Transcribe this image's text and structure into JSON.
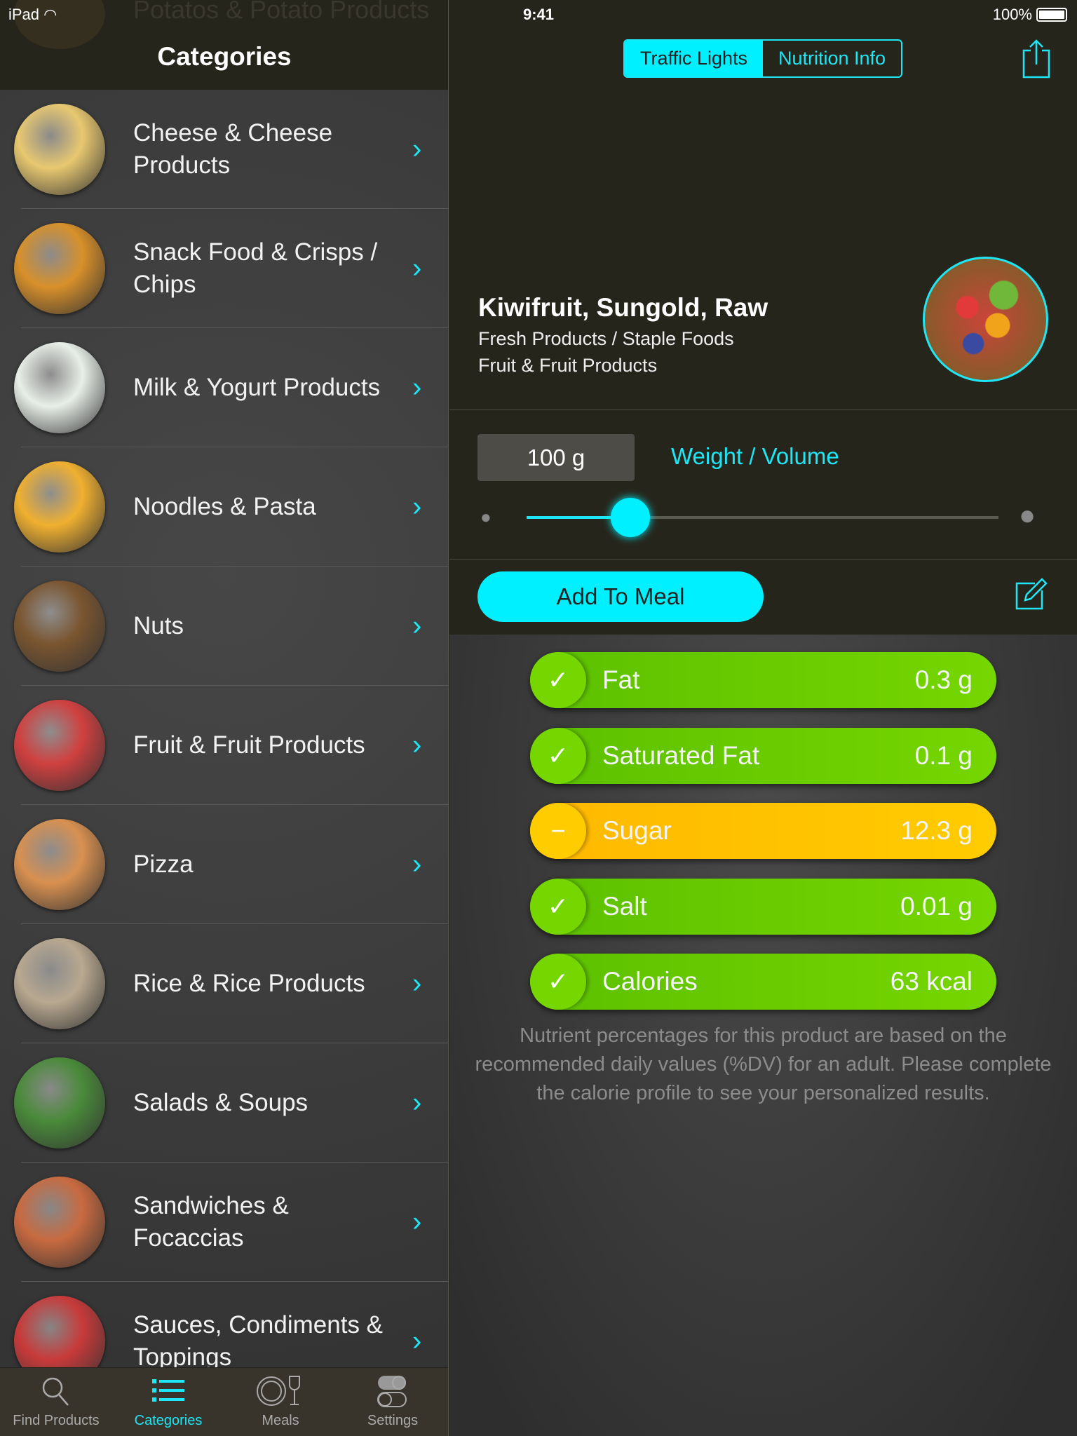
{
  "status": {
    "device": "iPad",
    "time": "9:41",
    "battery": "100%",
    "battery_level": 1.0
  },
  "left": {
    "title": "Categories",
    "ghost_label": "Potatos & Potato Products",
    "items": [
      {
        "label": "Cheese & Cheese Products",
        "color": "#e8c870"
      },
      {
        "label": "Snack Food & Crisps / Chips",
        "color": "#d8902a"
      },
      {
        "label": "Milk & Yogurt Products",
        "color": "#e8eee8"
      },
      {
        "label": "Noodles & Pasta",
        "color": "#f0b030"
      },
      {
        "label": "Nuts",
        "color": "#7a5530"
      },
      {
        "label": "Fruit & Fruit Products",
        "color": "#d04040"
      },
      {
        "label": "Pizza",
        "color": "#d89050"
      },
      {
        "label": "Rice & Rice Products",
        "color": "#b8a890"
      },
      {
        "label": "Salads & Soups",
        "color": "#4a8a3a"
      },
      {
        "label": "Sandwiches & Focaccias",
        "color": "#c86a40"
      },
      {
        "label": "Sauces, Condiments & Toppings",
        "color": "#c83a3a"
      }
    ],
    "tabs": [
      {
        "label": "Find Products",
        "icon": "search-icon"
      },
      {
        "label": "Categories",
        "icon": "list-icon",
        "active": true
      },
      {
        "label": "Meals",
        "icon": "plate-glass-icon"
      },
      {
        "label": "Settings",
        "icon": "toggle-icon"
      }
    ]
  },
  "right": {
    "segments": [
      "Traffic Lights",
      "Nutrition Info"
    ],
    "selected_segment": "Traffic Lights",
    "product": {
      "name": "Kiwifruit, Sungold, Raw",
      "category": "Fresh Products / Staple Foods",
      "subcategory": "Fruit & Fruit Products"
    },
    "weight": "100 g",
    "weight_label": "Weight / Volume",
    "slider_fraction": 0.22,
    "add_button": "Add To Meal",
    "nutrients": [
      {
        "label": "Fat",
        "value": "0.3 g",
        "status": "ok",
        "symbol": "✓",
        "color": "#76d600"
      },
      {
        "label": "Saturated Fat",
        "value": "0.1 g",
        "status": "ok",
        "symbol": "✓",
        "color": "#76d600"
      },
      {
        "label": "Sugar",
        "value": "12.3 g",
        "status": "medium",
        "symbol": "−",
        "color": "#ffcc00"
      },
      {
        "label": "Salt",
        "value": "0.01 g",
        "status": "ok",
        "symbol": "✓",
        "color": "#76d600"
      },
      {
        "label": "Calories",
        "value": "63 kcal",
        "status": "ok",
        "symbol": "✓",
        "color": "#76d600"
      }
    ],
    "note": "Nutrient percentages for this product are based on the recommended daily values (%DV) for an adult. Please complete the calorie profile to see your personalized results.",
    "accent": "#00f0ff"
  }
}
